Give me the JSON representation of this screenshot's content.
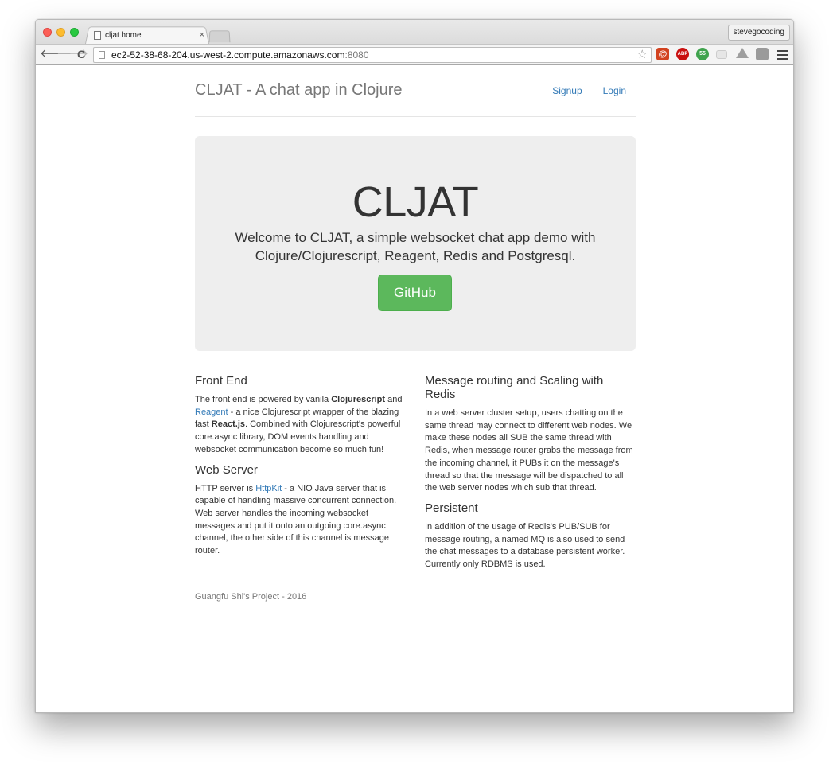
{
  "browser": {
    "tab_title": "cljat home",
    "tab_close": "×",
    "profile_name": "stevegocoding",
    "url_host": "ec2-52-38-68-204.us-west-2.compute.amazonaws.com",
    "url_port": ":8080",
    "back_glyph": "🡐",
    "forward_glyph": "🡒",
    "reload_glyph": "C",
    "star_glyph": "☆",
    "extensions": {
      "at": "@",
      "abp": "ABP",
      "num": "55"
    }
  },
  "header": {
    "brand": "CLJAT - A chat app in Clojure",
    "nav": [
      "Signup",
      "Login"
    ]
  },
  "jumbotron": {
    "title": "CLJAT",
    "lead": "Welcome to CLJAT, a simple websocket chat app demo with Clojure/Clojurescript, Reagent, Redis and Postgresql.",
    "button_label": "GitHub",
    "button_color": "#5cb85c"
  },
  "sections": {
    "front_end": {
      "heading": "Front End",
      "t1": "The front end is powered by vanila ",
      "b1": "Clojurescript",
      "t2": " and ",
      "link": "Reagent",
      "t3": " - a nice Clojurescript wrapper of the blazing fast ",
      "b2": "React.js",
      "t4": ". Combined with Clojurescript's powerful core.async library, DOM events handling and websocket communication become so much fun!"
    },
    "web_server": {
      "heading": "Web Server",
      "t1": "HTTP server is ",
      "link": "HttpKit",
      "t2": " - a NIO Java server that is capable of handling massive concurrent connection. Web server handles the incoming websocket messages and put it onto an outgoing core.async channel, the other side of this channel is message router."
    },
    "routing": {
      "heading": "Message routing and Scaling with Redis",
      "body": "In a web server cluster setup, users chatting on the same thread may connect to different web nodes. We make these nodes all SUB the same thread with Redis, when message router grabs the message from the incoming channel, it PUBs it on the message's thread so that the message will be dispatched to all the web server nodes which sub that thread."
    },
    "persistent": {
      "heading": "Persistent",
      "body": "In addition of the usage of Redis's PUB/SUB for message routing, a named MQ is also used to send the chat messages to a database persistent worker. Currently only RDBMS is used."
    }
  },
  "footer": {
    "text": "Guangfu Shi's Project - 2016"
  }
}
